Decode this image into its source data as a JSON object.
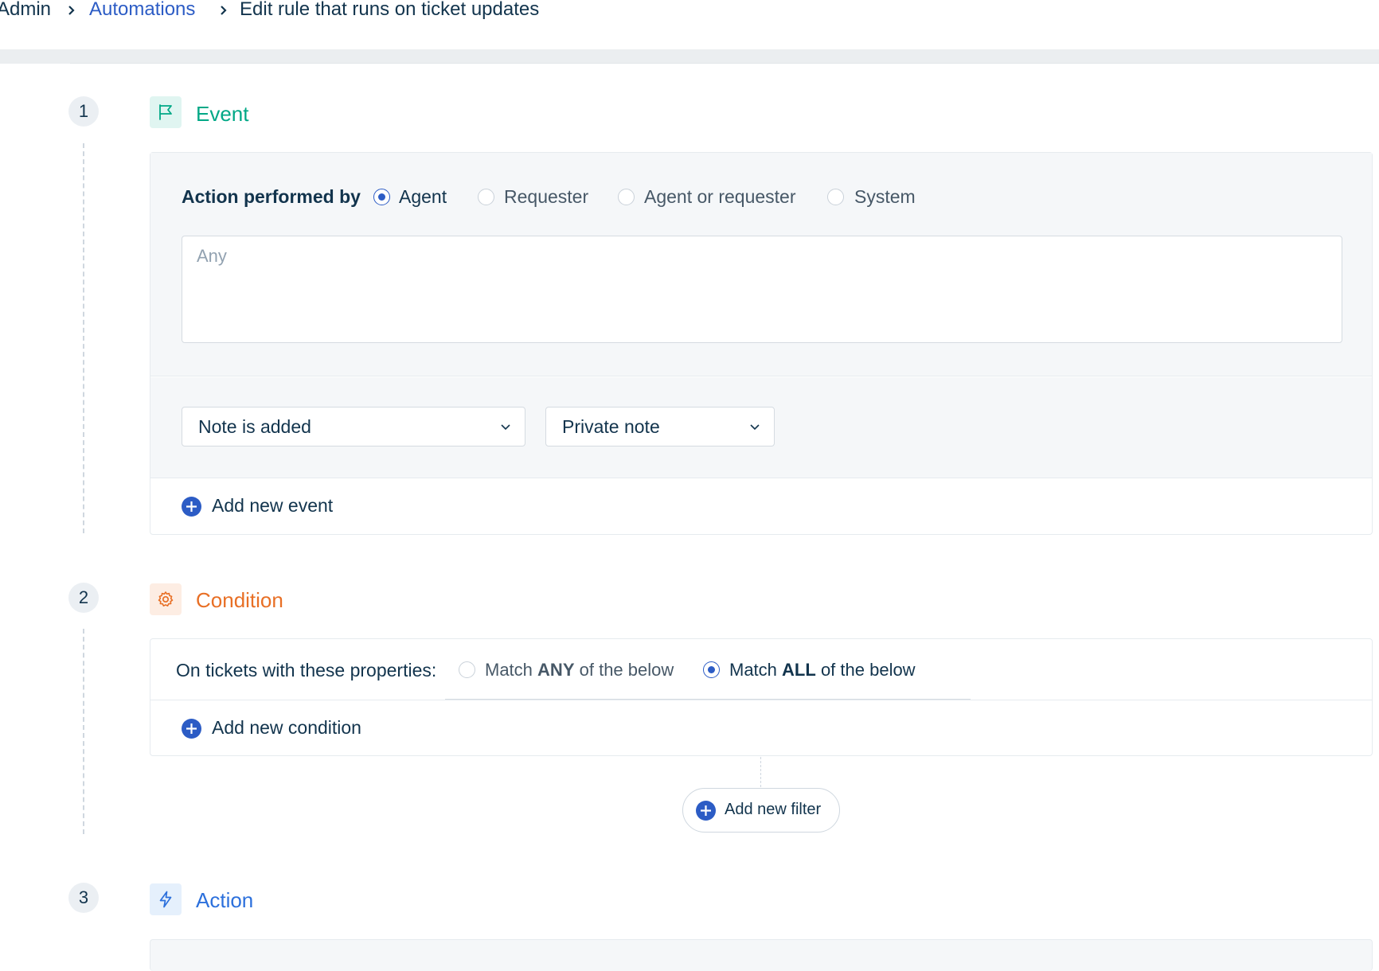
{
  "breadcrumb": {
    "root": "Admin",
    "section": "Automations",
    "current": "Edit rule that runs on ticket updates"
  },
  "colors": {
    "event": "#00a886",
    "condition": "#e86f25",
    "action": "#2c70dc",
    "link": "#2c5cc5",
    "text": "#12344d"
  },
  "steps": {
    "event": {
      "number": "1",
      "title": "Event",
      "icon": "flag-icon",
      "performed_by_label": "Action performed by",
      "performed_by_options": [
        "Agent",
        "Requester",
        "Agent or requester",
        "System"
      ],
      "performed_by_selected": "Agent",
      "agents_placeholder": "Any",
      "event_dropdown": "Note is added",
      "note_type_dropdown": "Private note",
      "add_event_label": "Add new event"
    },
    "condition": {
      "number": "2",
      "title": "Condition",
      "icon": "gear-icon",
      "properties_label": "On tickets with these properties:",
      "match_any": {
        "pre": "Match",
        "bold": "ANY",
        "post": "of the below"
      },
      "match_all": {
        "pre": "Match",
        "bold": "ALL",
        "post": "of the below"
      },
      "match_selected": "ALL",
      "add_condition_label": "Add new condition",
      "add_filter_label": "Add new filter"
    },
    "action": {
      "number": "3",
      "title": "Action",
      "icon": "lightning-icon"
    }
  }
}
